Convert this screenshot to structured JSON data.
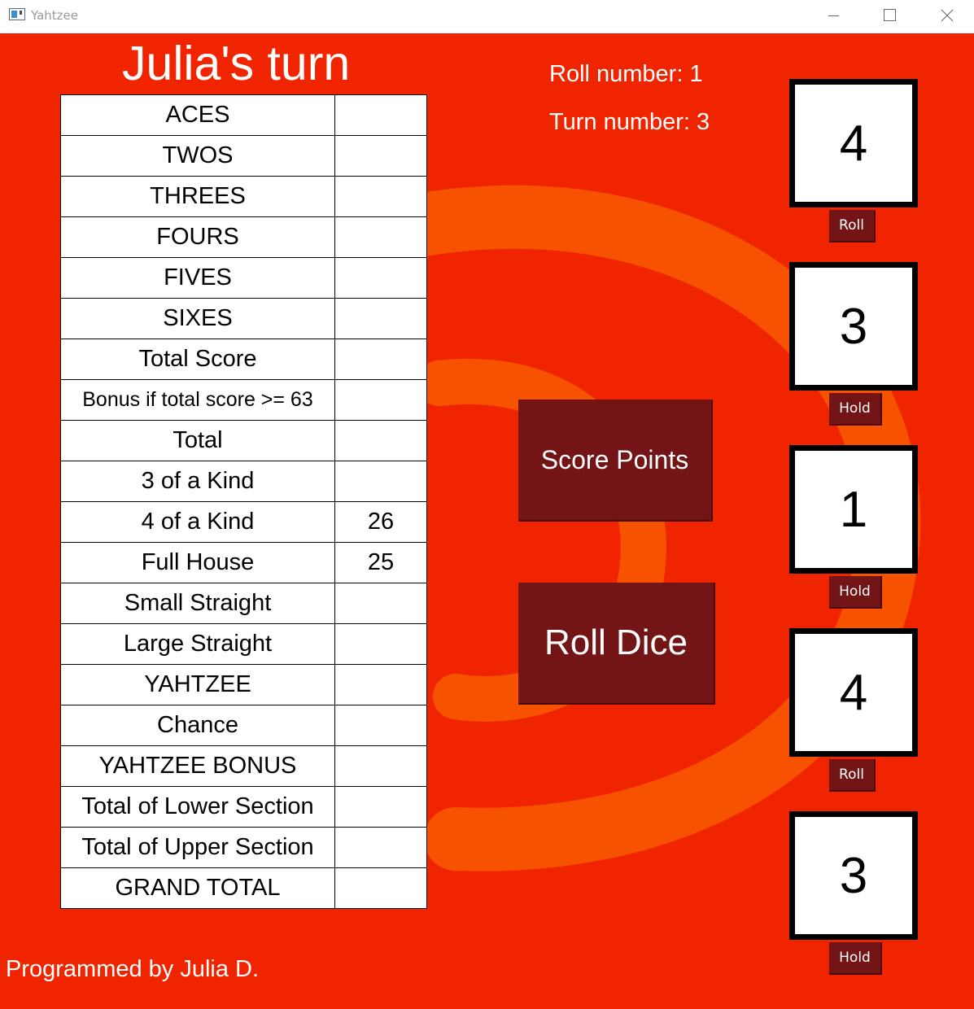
{
  "window": {
    "title": "Yahtzee"
  },
  "header": {
    "turn_title": "Julia's turn",
    "roll_number": "Roll number: 1",
    "turn_number": "Turn number: 3"
  },
  "scorecard": {
    "rows": [
      {
        "category": "ACES",
        "score": ""
      },
      {
        "category": "TWOS",
        "score": ""
      },
      {
        "category": "THREES",
        "score": ""
      },
      {
        "category": "FOURS",
        "score": ""
      },
      {
        "category": "FIVES",
        "score": ""
      },
      {
        "category": "SIXES",
        "score": ""
      },
      {
        "category": "Total Score",
        "score": ""
      },
      {
        "category": "Bonus if total score >= 63",
        "score": ""
      },
      {
        "category": "Total",
        "score": ""
      },
      {
        "category": "3 of a Kind",
        "score": ""
      },
      {
        "category": "4 of a Kind",
        "score": "26"
      },
      {
        "category": "Full House",
        "score": "25"
      },
      {
        "category": "Small Straight",
        "score": ""
      },
      {
        "category": "Large Straight",
        "score": ""
      },
      {
        "category": "YAHTZEE",
        "score": ""
      },
      {
        "category": "Chance",
        "score": ""
      },
      {
        "category": "YAHTZEE BONUS",
        "score": ""
      },
      {
        "category": "Total of Lower Section",
        "score": ""
      },
      {
        "category": "Total of Upper Section",
        "score": ""
      },
      {
        "category": "GRAND TOTAL",
        "score": ""
      }
    ]
  },
  "actions": {
    "score_points": "Score Points",
    "roll_dice": "Roll Dice"
  },
  "dice": [
    {
      "value": "4",
      "button": "Roll"
    },
    {
      "value": "3",
      "button": "Hold"
    },
    {
      "value": "1",
      "button": "Hold"
    },
    {
      "value": "4",
      "button": "Roll"
    },
    {
      "value": "3",
      "button": "Hold"
    }
  ],
  "footer": {
    "credit": "Programmed by Julia D."
  },
  "colors": {
    "background": "#f12400",
    "swirl": "#f65200",
    "button": "#731416"
  }
}
